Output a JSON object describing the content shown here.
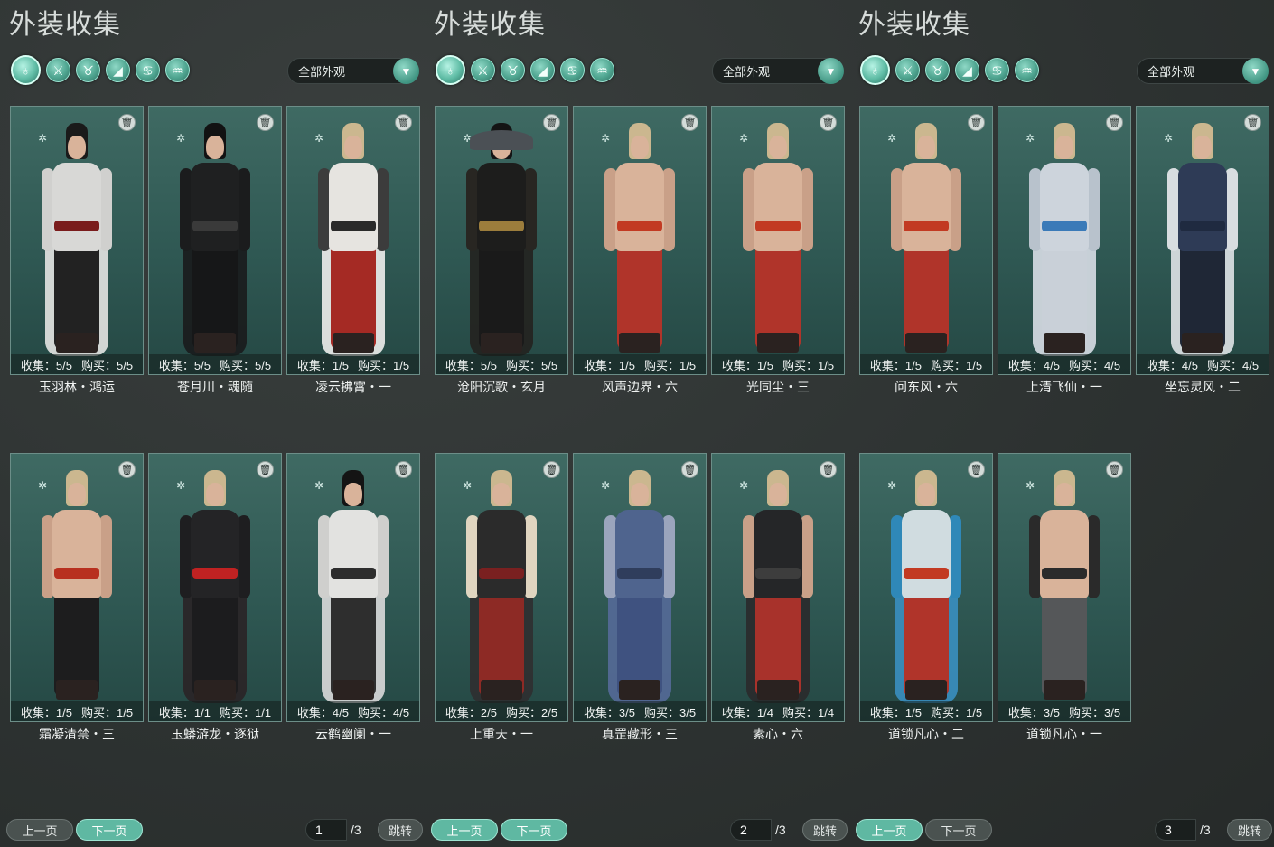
{
  "panels": [
    {
      "title": "外装收集",
      "filter": "全部外观",
      "prev_label": "上一页",
      "next_label": "下一页",
      "page_value": "1",
      "page_total": "/3",
      "jump_label": "跳转",
      "active_nav": "next",
      "cards": [
        {
          "stats_collect": "收集：5/5",
          "stats_buy": "购买：5/5",
          "name": "玉羽林・鸿运",
          "look": "white"
        },
        {
          "stats_collect": "收集：5/5",
          "stats_buy": "购买：5/5",
          "name": "苍月川・魂随",
          "look": "black"
        },
        {
          "stats_collect": "收集：1/5",
          "stats_buy": "购买：1/5",
          "name": "凌云拂霄・一",
          "look": "whitered"
        },
        {
          "stats_collect": "收集：1/5",
          "stats_buy": "购买：1/5",
          "name": "霜凝清禁・三",
          "look": "shirtless_black"
        },
        {
          "stats_collect": "收集：1/1",
          "stats_buy": "购买：1/1",
          "name": "玉蟒游龙・逐狱",
          "look": "blackred"
        },
        {
          "stats_collect": "收集：4/5",
          "stats_buy": "购买：4/5",
          "name": "云鹤幽阑・一",
          "look": "whiteblack"
        }
      ]
    },
    {
      "title": "外装收集",
      "filter": "全部外观",
      "prev_label": "上一页",
      "next_label": "下一页",
      "page_value": "2",
      "page_total": "/3",
      "jump_label": "跳转",
      "active_nav": "both",
      "cards": [
        {
          "stats_collect": "收集：5/5",
          "stats_buy": "购买：5/5",
          "name": "沧阳沉歌・玄月",
          "look": "blackgold"
        },
        {
          "stats_collect": "收集：1/5",
          "stats_buy": "购买：1/5",
          "name": "风声边界・六",
          "look": "shirtless_red"
        },
        {
          "stats_collect": "收集：1/5",
          "stats_buy": "购买：1/5",
          "name": "光同尘・三",
          "look": "shirtless_red"
        },
        {
          "stats_collect": "收集：2/5",
          "stats_buy": "购买：2/5",
          "name": "上重天・一",
          "look": "darkred"
        },
        {
          "stats_collect": "收集：3/5",
          "stats_buy": "购买：3/5",
          "name": "真罡藏形・三",
          "look": "blue"
        },
        {
          "stats_collect": "收集：1/4",
          "stats_buy": "购买：1/4",
          "name": "素心・六",
          "look": "vestred"
        }
      ]
    },
    {
      "title": "外装收集",
      "filter": "全部外观",
      "prev_label": "上一页",
      "next_label": "下一页",
      "page_value": "3",
      "page_total": "/3",
      "jump_label": "跳转",
      "active_nav": "prev",
      "cards": [
        {
          "stats_collect": "收集：1/5",
          "stats_buy": "购买：1/5",
          "name": "问东风・六",
          "look": "shirtless_red"
        },
        {
          "stats_collect": "收集：4/5",
          "stats_buy": "购买：4/5",
          "name": "上清飞仙・一",
          "look": "whiteblue"
        },
        {
          "stats_collect": "收集：4/5",
          "stats_buy": "购买：4/5",
          "name": "坐忘灵风・二",
          "look": "whitenavy"
        },
        {
          "stats_collect": "收集：1/5",
          "stats_buy": "购买：1/5",
          "name": "道锁凡心・二",
          "look": "tealwhite"
        },
        {
          "stats_collect": "收集：3/5",
          "stats_buy": "购买：3/5",
          "name": "道锁凡心・一",
          "look": "shirtless_grey"
        }
      ]
    }
  ],
  "category_icons": [
    "robe-icon",
    "top-icon",
    "pants-icon",
    "shoe-icon",
    "accessory-icon",
    "hair-icon"
  ],
  "colors": {
    "accent": "#5fb8a2",
    "card_bg": "#2f5853",
    "page_bg": "#2f3433"
  }
}
